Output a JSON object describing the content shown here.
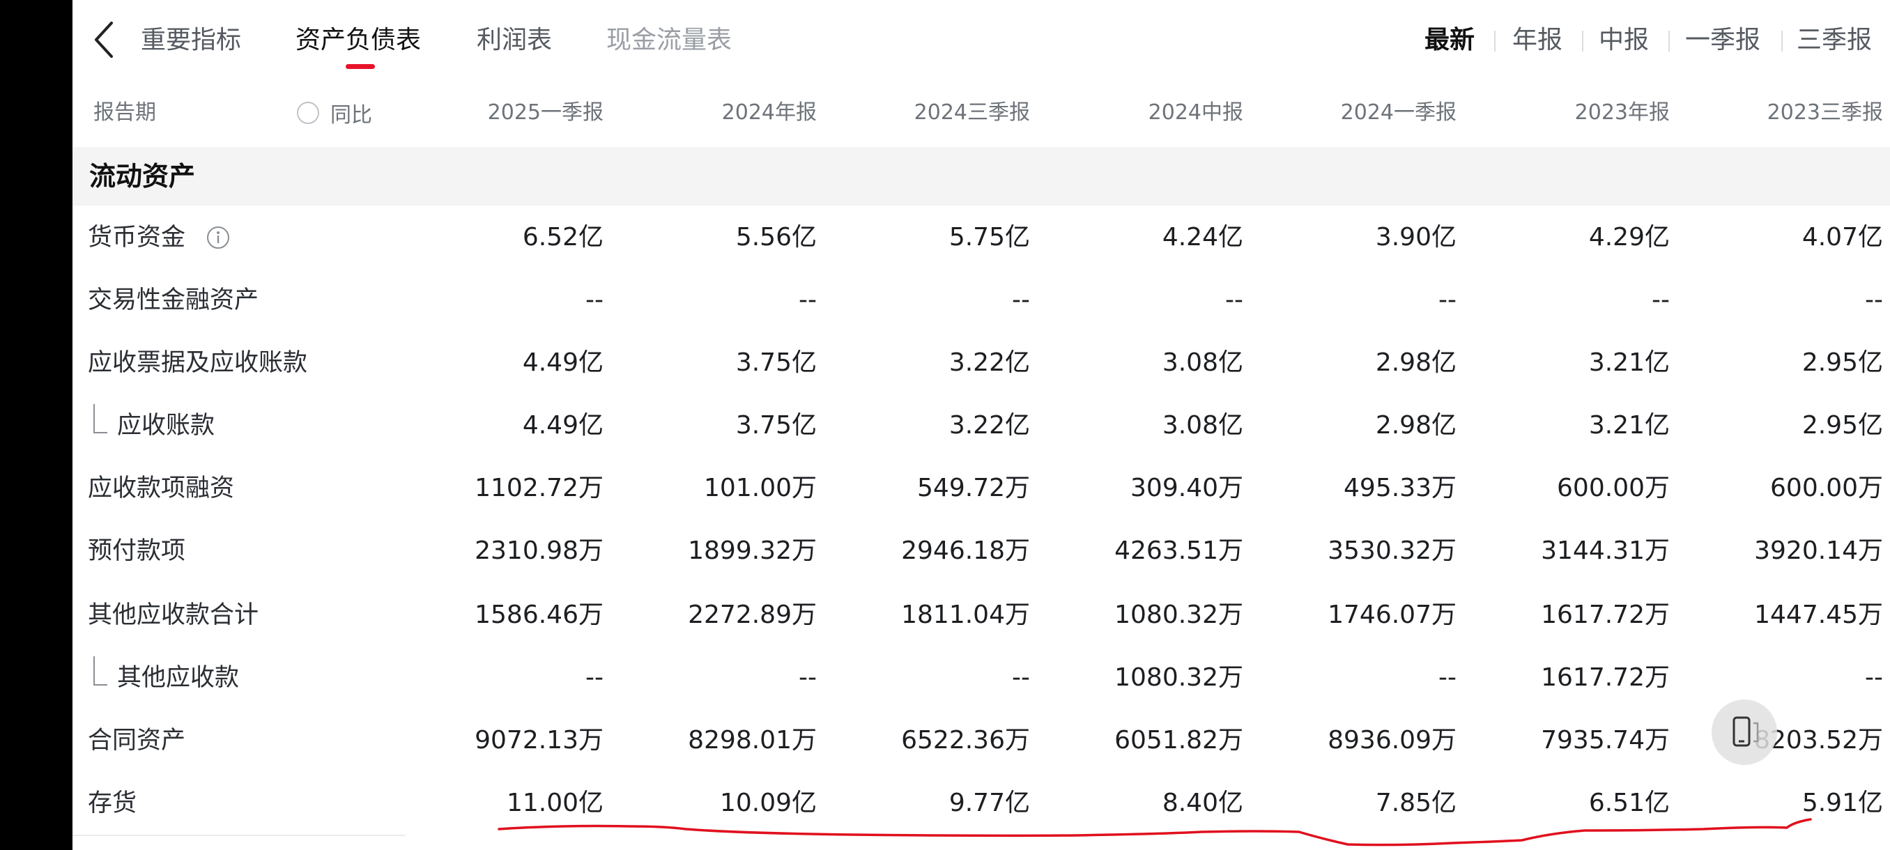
{
  "tabs": [
    {
      "label": "重要指标"
    },
    {
      "label": "资产负债表"
    },
    {
      "label": "利润表"
    },
    {
      "label": "现金流量表"
    }
  ],
  "period_filters": [
    "最新",
    "年报",
    "中报",
    "一季报",
    "三季报"
  ],
  "header": {
    "period_label": "报告期",
    "yoy_label": "同比",
    "columns": [
      "2025一季报",
      "2024年报",
      "2024三季报",
      "2024中报",
      "2024一季报",
      "2023年报",
      "2023三季报"
    ]
  },
  "section": {
    "title": "流动资产"
  },
  "rows": [
    {
      "label": "货币资金",
      "values": [
        "6.52亿",
        "5.56亿",
        "5.75亿",
        "4.24亿",
        "3.90亿",
        "4.29亿",
        "4.07亿"
      ]
    },
    {
      "label": "交易性金融资产",
      "values": [
        "--",
        "--",
        "--",
        "--",
        "--",
        "--",
        "--"
      ]
    },
    {
      "label": "应收票据及应收账款",
      "values": [
        "4.49亿",
        "3.75亿",
        "3.22亿",
        "3.08亿",
        "2.98亿",
        "3.21亿",
        "2.95亿"
      ]
    },
    {
      "label": "应收账款",
      "values": [
        "4.49亿",
        "3.75亿",
        "3.22亿",
        "3.08亿",
        "2.98亿",
        "3.21亿",
        "2.95亿"
      ]
    },
    {
      "label": "应收款项融资",
      "values": [
        "1102.72万",
        "101.00万",
        "549.72万",
        "309.40万",
        "495.33万",
        "600.00万",
        "600.00万"
      ]
    },
    {
      "label": "预付款项",
      "values": [
        "2310.98万",
        "1899.32万",
        "2946.18万",
        "4263.51万",
        "3530.32万",
        "3144.31万",
        "3920.14万"
      ]
    },
    {
      "label": "其他应收款合计",
      "values": [
        "1586.46万",
        "2272.89万",
        "1811.04万",
        "1080.32万",
        "1746.07万",
        "1617.72万",
        "1447.45万"
      ]
    },
    {
      "label": "其他应收款",
      "values": [
        "--",
        "--",
        "--",
        "1080.32万",
        "--",
        "1617.72万",
        "--"
      ]
    },
    {
      "label": "合同资产",
      "values": [
        "9072.13万",
        "8298.01万",
        "6522.36万",
        "6051.82万",
        "8936.09万",
        "7935.74万",
        "8203.52万"
      ]
    },
    {
      "label": "存货",
      "values": [
        "11.00亿",
        "10.09亿",
        "9.77亿",
        "8.40亿",
        "7.85亿",
        "6.51亿",
        "5.91亿"
      ]
    }
  ],
  "colors": {
    "accent": "#e8132a",
    "annotation": "#e0101e"
  }
}
